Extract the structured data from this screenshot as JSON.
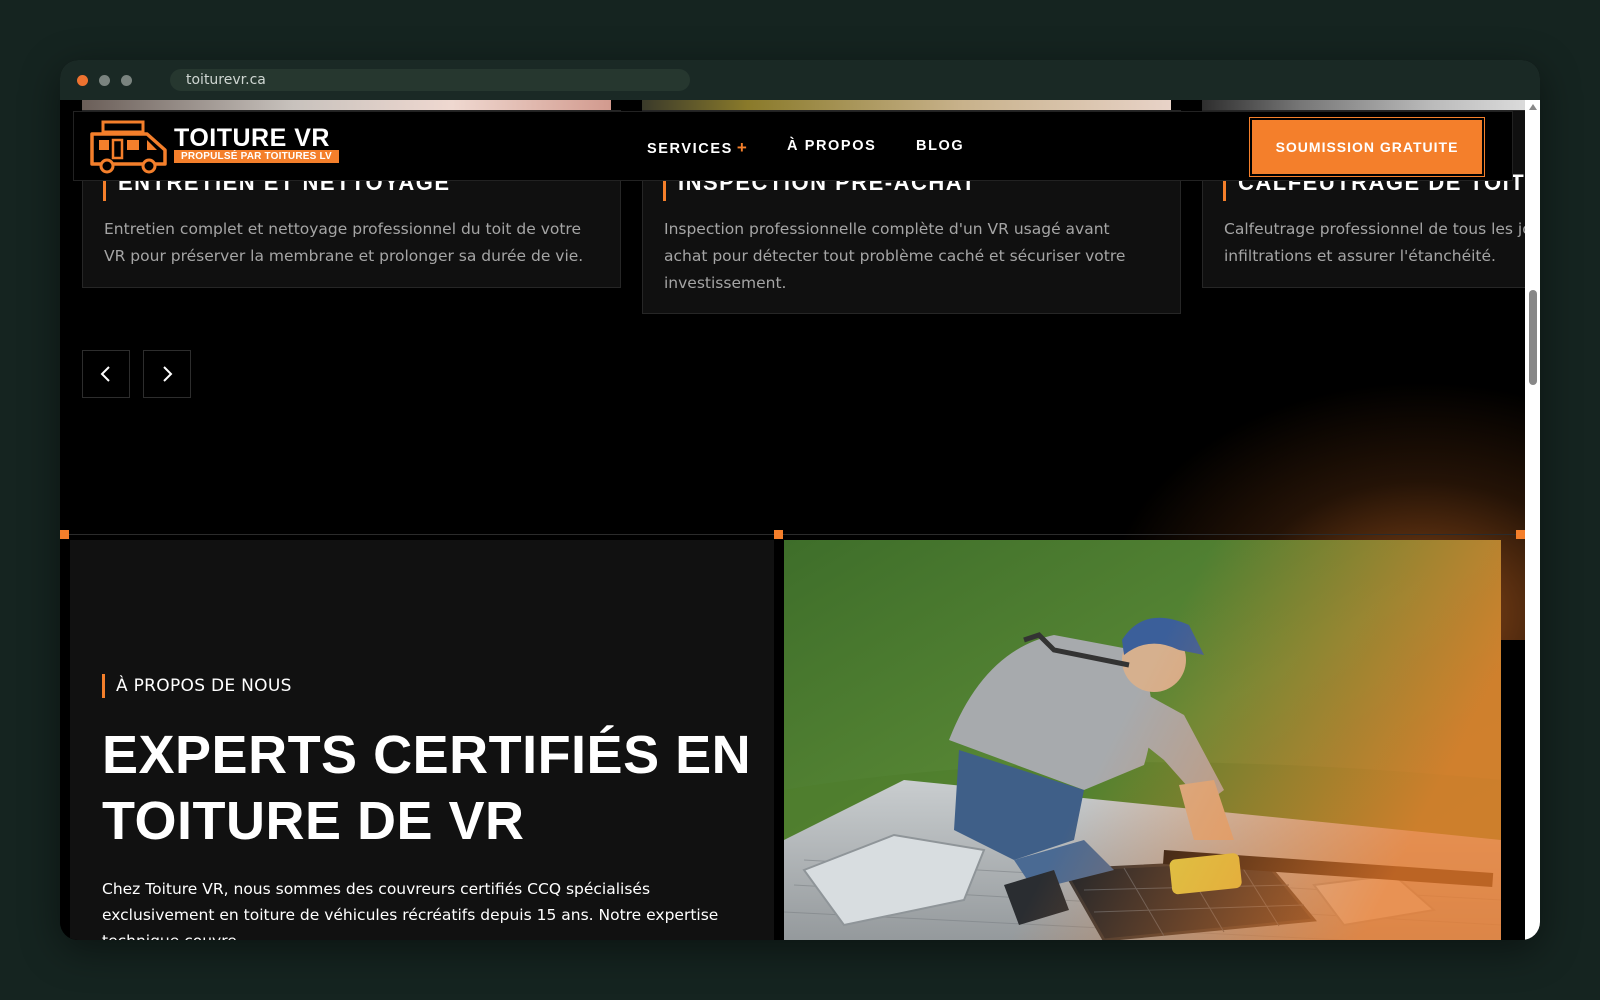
{
  "browser": {
    "url": "toiturevr.ca"
  },
  "header": {
    "logo_title": "TOITURE VR",
    "logo_subtitle": "PROPULSÉ PAR TOITURES LV",
    "nav": {
      "services": "SERVICES",
      "services_plus": "+",
      "about": "À PROPOS",
      "blog": "BLOG"
    },
    "cta": "SOUMISSION GRATUITE"
  },
  "cards": [
    {
      "title": "ENTRETIEN ET NETTOYAGE",
      "text": "Entretien complet et nettoyage professionnel du toit de votre VR pour préserver la membrane et prolonger sa durée de vie."
    },
    {
      "title": "INSPECTION PRÉ-ACHAT",
      "text": "Inspection professionnelle complète d'un VR usagé avant achat pour détecter tout problème caché et sécuriser votre investissement."
    },
    {
      "title": "CALFEUTRAGE DE TOIT",
      "text": "Calfeutrage professionnel de tous les joints pour prévenir les infiltrations et assurer l'étanchéité."
    }
  ],
  "about": {
    "tag": "À PROPOS DE NOUS",
    "title": "EXPERTS CERTIFIÉS EN TOITURE DE VR",
    "text": "Chez Toiture VR, nous sommes des couvreurs certifiés CCQ spécialisés exclusivement en toiture de véhicules récréatifs depuis 15 ans. Notre expertise technique couvre"
  },
  "colors": {
    "accent": "#f47f2b",
    "background": "#000000",
    "panel": "#111111"
  }
}
